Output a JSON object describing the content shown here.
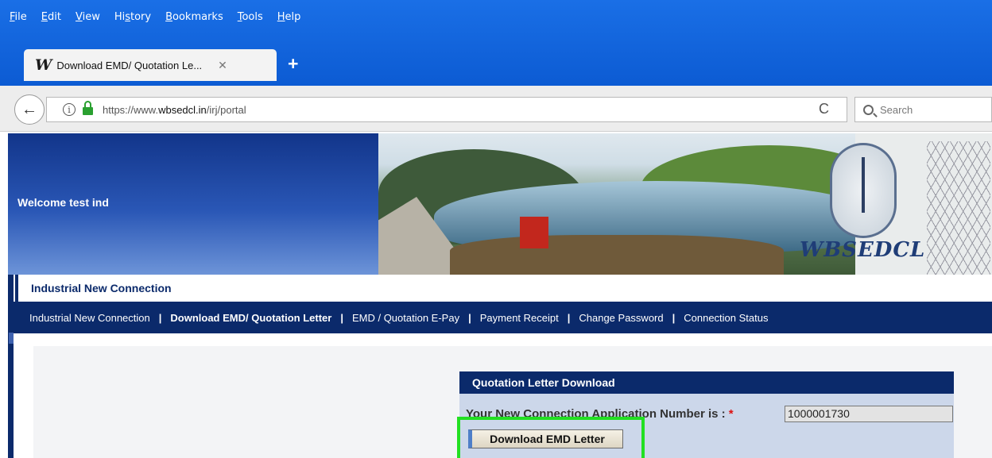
{
  "browser": {
    "menu": [
      "File",
      "Edit",
      "View",
      "History",
      "Bookmarks",
      "Tools",
      "Help"
    ],
    "tab": {
      "title": "Download EMD/ Quotation Le...",
      "favicon": "W",
      "close": "✕"
    },
    "new_tab": "+",
    "url": {
      "prefix": "https://www.",
      "host": "wbsedcl.in",
      "path": "/irj/portal"
    },
    "search_placeholder": "Search",
    "icons": {
      "back": "←",
      "reload": "C"
    }
  },
  "banner": {
    "welcome": "Welcome test ind",
    "logo_text": "WBSEDCL"
  },
  "portal": {
    "tab_label": "Industrial New Connection",
    "nav": [
      {
        "label": "Industrial New Connection",
        "active": false
      },
      {
        "label": "Download EMD/ Quotation Letter",
        "active": true
      },
      {
        "label": "EMD / Quotation E-Pay",
        "active": false
      },
      {
        "label": "Payment Receipt",
        "active": false
      },
      {
        "label": "Change Password",
        "active": false
      },
      {
        "label": "Connection Status",
        "active": false
      }
    ],
    "separator": "|"
  },
  "panel": {
    "header": "Quotation Letter Download",
    "app_label": "Your New Connection Application Number is :",
    "required_star": "*",
    "app_number": "1000001730",
    "button_label": "Download EMD Letter"
  },
  "colors": {
    "nav_dark": "#0b2a6b",
    "highlight": "#22e022",
    "chrome_blue": "#1a6fe6"
  }
}
